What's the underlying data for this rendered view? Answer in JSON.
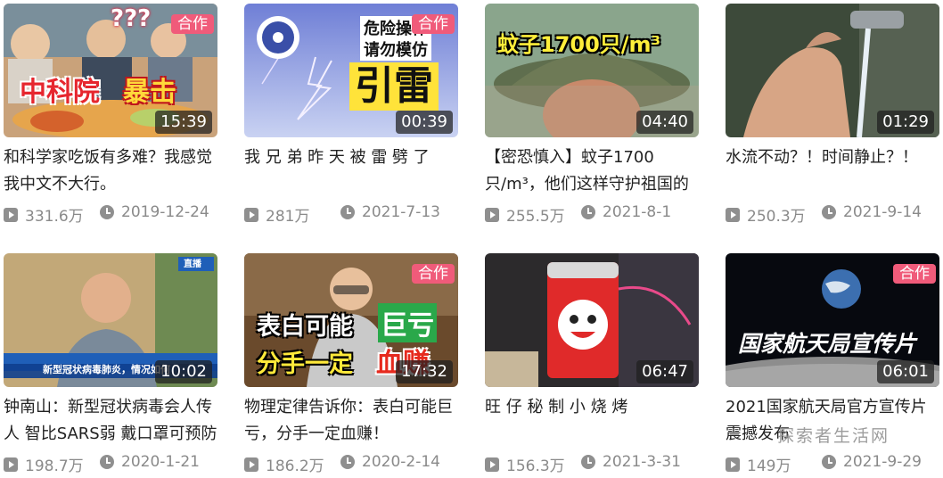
{
  "colors": {
    "badge": "#f05b7a",
    "meta_text": "#8a8a8a",
    "duration_bg": "#1e1e1e"
  },
  "videos": [
    {
      "thumb_text": [
        "???",
        "中科院",
        "暴击"
      ],
      "badge": "合作",
      "duration": "15:39",
      "title": "和科学家吃饭有多难？我感觉我中文不大行。",
      "views": "331.6万",
      "date": "2019-12-24"
    },
    {
      "thumb_text": [
        "危险操作",
        "请勿模仿",
        "引雷"
      ],
      "badge": "合作",
      "duration": "00:39",
      "title": "我 兄 弟 昨 天 被 雷 劈 了",
      "views": "281万",
      "date": "2021-7-13"
    },
    {
      "thumb_text": [
        "蚊子1700只/m³"
      ],
      "badge": "",
      "duration": "04:40",
      "title": "【密恐慎入】蚊子1700只/m³，他们这样守护祖国的",
      "views": "255.5万",
      "date": "2021-8-1"
    },
    {
      "thumb_text": [],
      "badge": "",
      "duration": "01:29",
      "title": "水流不动？！时间静止？！",
      "views": "250.3万",
      "date": "2021-9-14"
    },
    {
      "thumb_text": [
        "直播",
        "新型冠状病毒肺炎，情况如何"
      ],
      "badge": "",
      "duration": "10:02",
      "title": "钟南山：新型冠状病毒会人传人 智比SARS弱 戴口罩可预防",
      "views": "198.7万",
      "date": "2020-1-21"
    },
    {
      "thumb_text": [
        "表白可能",
        "巨亏",
        "分手一定",
        "血赚"
      ],
      "badge": "合作",
      "duration": "17:32",
      "title": "物理定律告诉你：表白可能巨亏，分手一定血赚！",
      "views": "186.2万",
      "date": "2020-2-14"
    },
    {
      "thumb_text": [],
      "badge": "",
      "duration": "06:47",
      "title": "旺 仔 秘 制 小 烧 烤",
      "views": "156.3万",
      "date": "2021-3-31"
    },
    {
      "thumb_text": [
        "国家航天局宣传片"
      ],
      "badge": "合作",
      "duration": "06:01",
      "title": "2021国家航天局官方宣传片 震撼发布",
      "views": "149万",
      "date": "2021-9-29"
    }
  ],
  "watermark": "探索者生活网"
}
